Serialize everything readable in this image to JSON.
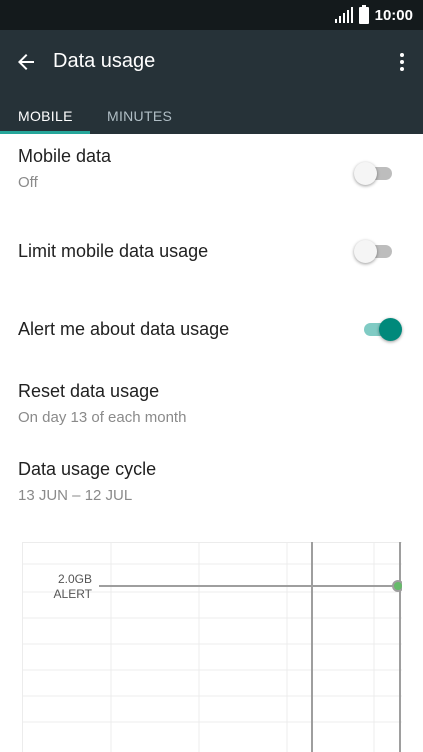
{
  "status_bar": {
    "time": "10:00"
  },
  "app_bar": {
    "title": "Data usage"
  },
  "tabs": [
    {
      "label": "MOBILE",
      "selected": true
    },
    {
      "label": "MINUTES",
      "selected": false
    }
  ],
  "settings": {
    "mobile_data": {
      "label": "Mobile data",
      "summary": "Off",
      "enabled": false
    },
    "limit_mobile_data": {
      "label": "Limit mobile data usage",
      "enabled": false
    },
    "alert_data_usage": {
      "label": "Alert me about data usage",
      "enabled": true
    },
    "reset_data_usage": {
      "label": "Reset data usage",
      "summary": "On day 13 of each month"
    },
    "data_usage_cycle": {
      "label": "Data usage cycle",
      "summary": "13 JUN – 12 JUL"
    }
  },
  "chart": {
    "alert_value": "2.0GB",
    "alert_label": "ALERT"
  },
  "colors": {
    "app_bar": "#263238",
    "status_bar": "#141a1c",
    "accent": "#26a69a",
    "toggle_on_thumb": "#00897b"
  }
}
